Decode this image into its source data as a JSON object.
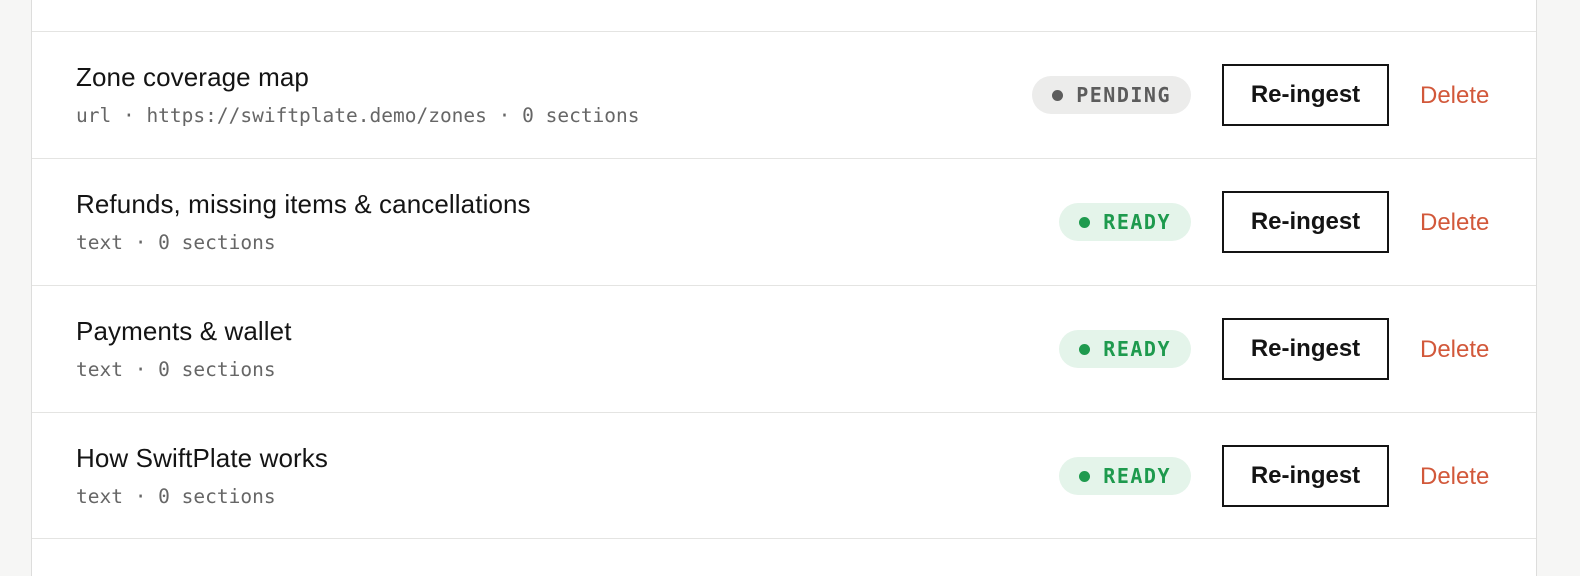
{
  "sources": [
    {
      "title": "Zone coverage map",
      "meta": "url · https://swiftplate.demo/zones · 0 sections",
      "status": "PENDING",
      "status_kind": "pending",
      "reingest_label": "Re-ingest",
      "delete_label": "Delete"
    },
    {
      "title": "Refunds, missing items & cancellations",
      "meta": "text · 0 sections",
      "status": "READY",
      "status_kind": "ready",
      "reingest_label": "Re-ingest",
      "delete_label": "Delete"
    },
    {
      "title": "Payments & wallet",
      "meta": "text · 0 sections",
      "status": "READY",
      "status_kind": "ready",
      "reingest_label": "Re-ingest",
      "delete_label": "Delete"
    },
    {
      "title": "How SwiftPlate works",
      "meta": "text · 0 sections",
      "status": "READY",
      "status_kind": "ready",
      "reingest_label": "Re-ingest",
      "delete_label": "Delete"
    }
  ],
  "colors": {
    "pending_text": "#5c5c5c",
    "pending_bg": "#ececeb",
    "ready_text": "#1e9a4e",
    "ready_bg": "#e4f4ea",
    "delete_text": "#d2583a"
  }
}
